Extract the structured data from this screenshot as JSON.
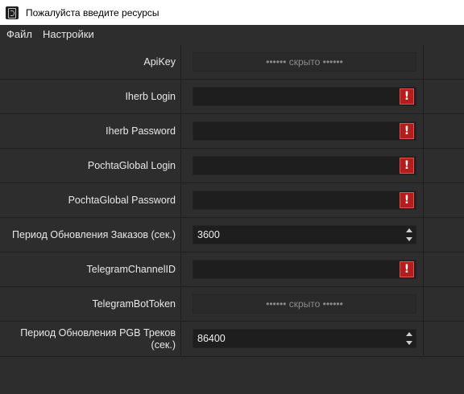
{
  "window": {
    "title": "Пожалуйста введите ресурсы",
    "icon": "app-icon"
  },
  "menu": {
    "items": [
      "Файл",
      "Настройки"
    ]
  },
  "fields": [
    {
      "label": "ApiKey",
      "type": "hidden",
      "display": "•••••• скрыто ••••••"
    },
    {
      "label": "Iherb Login",
      "type": "text",
      "value": "",
      "warning": "!"
    },
    {
      "label": "Iherb Password",
      "type": "text",
      "value": "",
      "warning": "!"
    },
    {
      "label": "PochtaGlobal Login",
      "type": "text",
      "value": "",
      "warning": "!"
    },
    {
      "label": "PochtaGlobal Password",
      "type": "text",
      "value": "",
      "warning": "!"
    },
    {
      "label": "Период Обновления Заказов (сек.)",
      "type": "spin",
      "value": "3600"
    },
    {
      "label": "TelegramChannelID",
      "type": "text",
      "value": "",
      "warning": "!"
    },
    {
      "label": "TelegramBotToken",
      "type": "hidden",
      "display": "•••••• скрыто ••••••"
    },
    {
      "label": "Период Обновления PGB Треков (сек.)",
      "type": "spin",
      "value": "86400"
    }
  ],
  "colors": {
    "warning": "#b71c1c",
    "background": "#2d2d2d",
    "input": "#1e1e1e"
  }
}
